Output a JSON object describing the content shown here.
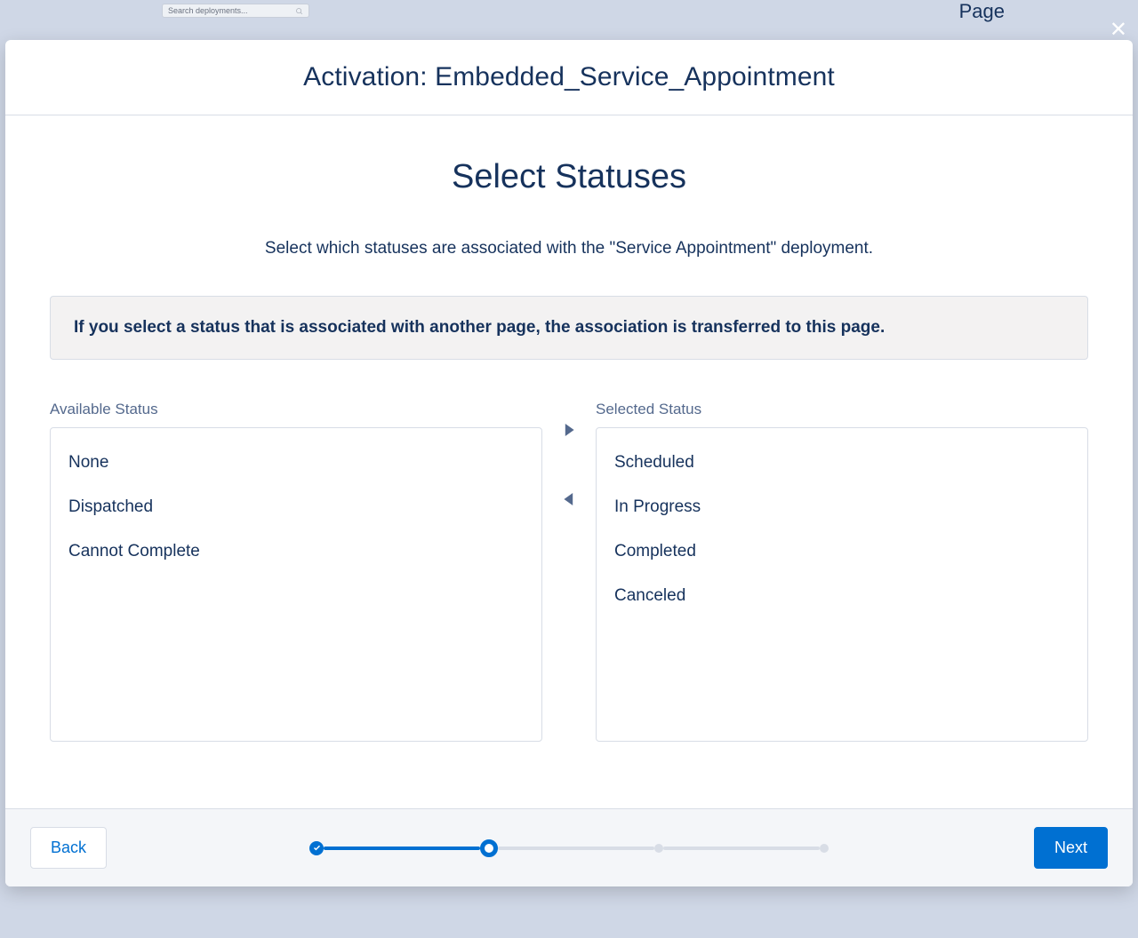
{
  "background": {
    "search_placeholder": "Search deployments...",
    "page_label": "Page"
  },
  "modal": {
    "close_symbol": "✕",
    "header_title": "Activation: Embedded_Service_Appointment",
    "page_title": "Select Statuses",
    "subtitle": "Select which statuses are associated with the \"Service Appointment\" deployment.",
    "info_banner": "If you select a status that is associated with another page, the association is transferred to this page.",
    "available_label": "Available Status",
    "selected_label": "Selected Status",
    "available_items": [
      "None",
      "Dispatched",
      "Cannot Complete"
    ],
    "selected_items": [
      "Scheduled",
      "In Progress",
      "Completed",
      "Canceled"
    ],
    "back_label": "Back",
    "next_label": "Next",
    "progress": {
      "total_steps": 4,
      "current_step": 2
    }
  }
}
